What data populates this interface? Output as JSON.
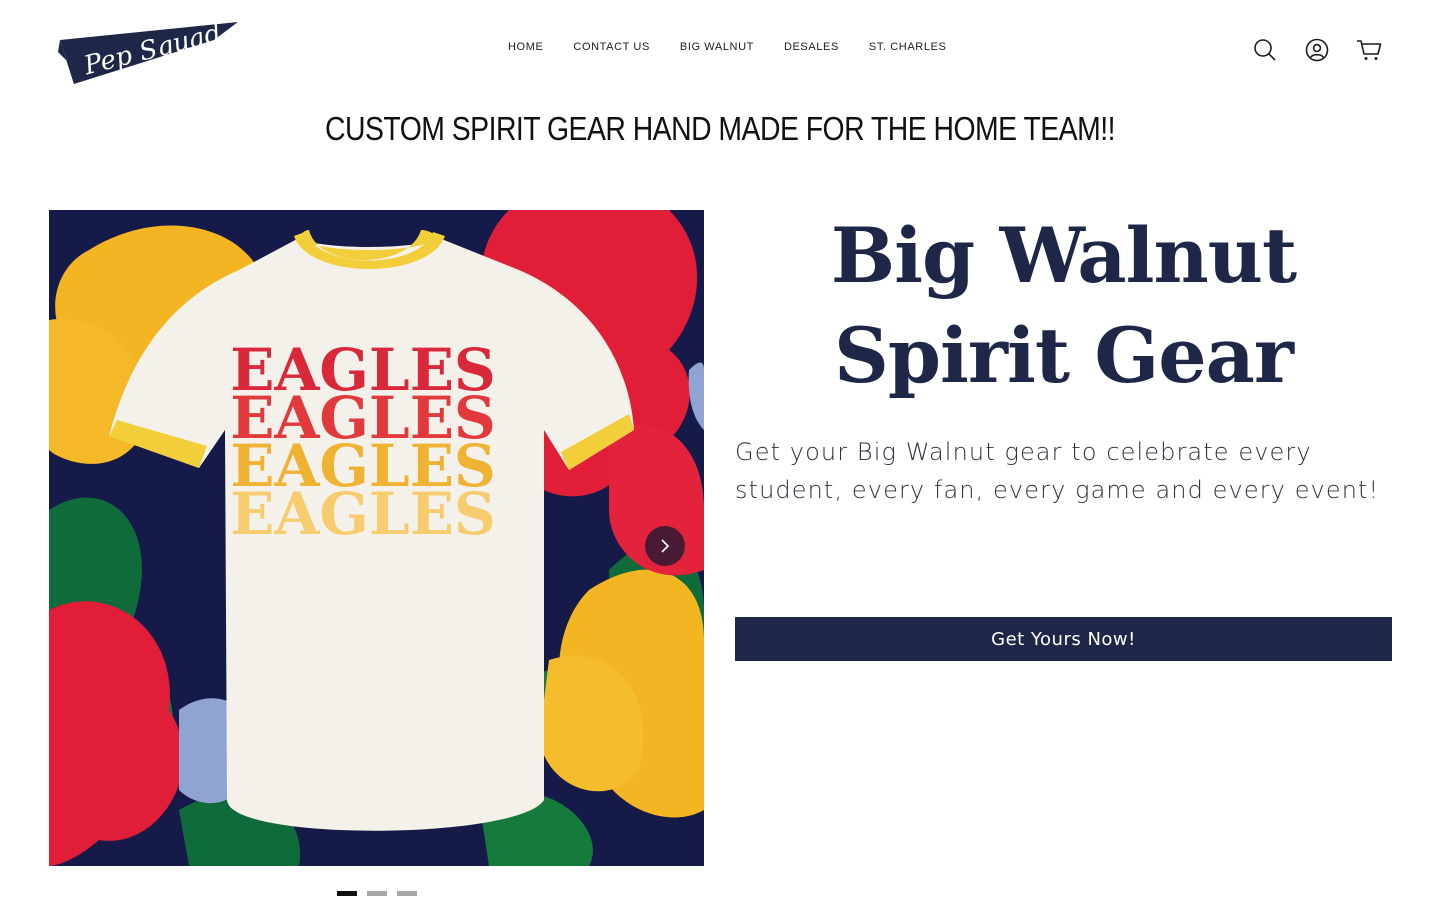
{
  "brand": {
    "logo_text": "Pep Squad",
    "primary_color": "#1f2748"
  },
  "nav": {
    "items": [
      {
        "label": "HOME"
      },
      {
        "label": "CONTACT US"
      },
      {
        "label": "BIG WALNUT"
      },
      {
        "label": "DESALES"
      },
      {
        "label": "ST. CHARLES"
      }
    ]
  },
  "header_icons": [
    "search-icon",
    "account-icon",
    "cart-icon"
  ],
  "announcement": {
    "text": "CUSTOM SPIRIT GEAR HAND MADE FOR THE HOME TEAM!!"
  },
  "hero": {
    "shirt_text": [
      "EAGLES",
      "EAGLES",
      "EAGLES",
      "EAGLES"
    ],
    "shirt_text_colors": [
      "#d8283a",
      "#e23a3c",
      "#f0b232",
      "#f6cc6e"
    ],
    "title": "Big Walnut Spirit Gear",
    "description": "Get your Big Walnut gear to celebrate every student, every fan, every game and every event!",
    "cta_label": "Get Yours Now!",
    "slides_count": 3,
    "active_slide": 1
  }
}
